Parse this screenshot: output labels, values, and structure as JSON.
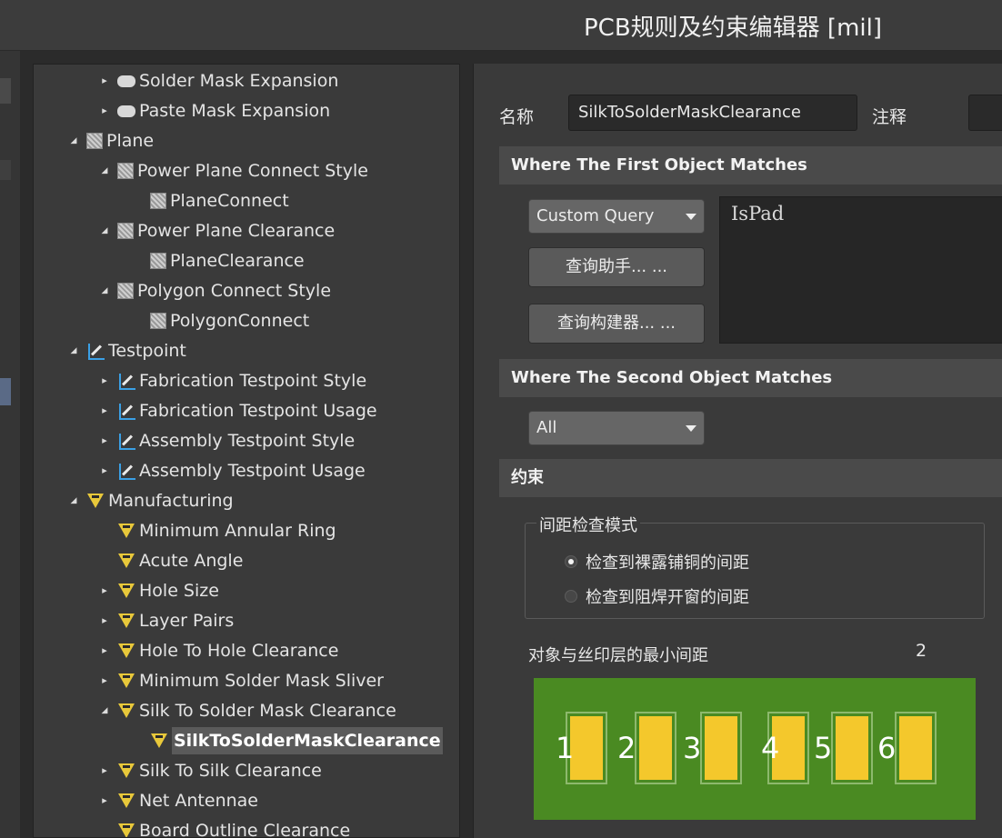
{
  "window": {
    "title": "PCB规则及约束编辑器 [mil]"
  },
  "tree": {
    "items": [
      {
        "label": "Solder Mask Expansion",
        "level": 2,
        "arrow": "collapsed",
        "icon": "mask-icon"
      },
      {
        "label": "Paste Mask Expansion",
        "level": 2,
        "arrow": "collapsed",
        "icon": "mask-icon"
      },
      {
        "label": "Plane",
        "level": 1,
        "arrow": "expanded",
        "icon": "plane-icon"
      },
      {
        "label": "Power Plane Connect Style",
        "level": 2,
        "arrow": "expanded",
        "icon": "plane-icon"
      },
      {
        "label": "PlaneConnect",
        "level": 3,
        "arrow": "none",
        "icon": "plane-icon"
      },
      {
        "label": "Power Plane Clearance",
        "level": 2,
        "arrow": "expanded",
        "icon": "plane-icon"
      },
      {
        "label": "PlaneClearance",
        "level": 3,
        "arrow": "none",
        "icon": "plane-icon"
      },
      {
        "label": "Polygon Connect Style",
        "level": 2,
        "arrow": "expanded",
        "icon": "plane-icon"
      },
      {
        "label": "PolygonConnect",
        "level": 3,
        "arrow": "none",
        "icon": "plane-icon"
      },
      {
        "label": "Testpoint",
        "level": 1,
        "arrow": "expanded",
        "icon": "testpoint-icon"
      },
      {
        "label": "Fabrication Testpoint Style",
        "level": 2,
        "arrow": "collapsed",
        "icon": "testpoint-icon"
      },
      {
        "label": "Fabrication Testpoint Usage",
        "level": 2,
        "arrow": "collapsed",
        "icon": "testpoint-icon"
      },
      {
        "label": "Assembly Testpoint Style",
        "level": 2,
        "arrow": "collapsed",
        "icon": "testpoint-icon"
      },
      {
        "label": "Assembly Testpoint Usage",
        "level": 2,
        "arrow": "collapsed",
        "icon": "testpoint-icon"
      },
      {
        "label": "Manufacturing",
        "level": 1,
        "arrow": "expanded",
        "icon": "manufacturing-icon"
      },
      {
        "label": "Minimum Annular Ring",
        "level": 2,
        "arrow": "none",
        "icon": "manufacturing-icon"
      },
      {
        "label": "Acute Angle",
        "level": 2,
        "arrow": "none",
        "icon": "manufacturing-icon"
      },
      {
        "label": "Hole Size",
        "level": 2,
        "arrow": "collapsed",
        "icon": "manufacturing-icon"
      },
      {
        "label": "Layer Pairs",
        "level": 2,
        "arrow": "collapsed",
        "icon": "manufacturing-icon"
      },
      {
        "label": "Hole To Hole Clearance",
        "level": 2,
        "arrow": "collapsed",
        "icon": "manufacturing-icon"
      },
      {
        "label": "Minimum Solder Mask Sliver",
        "level": 2,
        "arrow": "collapsed",
        "icon": "manufacturing-icon"
      },
      {
        "label": "Silk To Solder Mask Clearance",
        "level": 2,
        "arrow": "expanded",
        "icon": "manufacturing-icon"
      },
      {
        "label": "SilkToSolderMaskClearance",
        "level": 3,
        "arrow": "none",
        "icon": "manufacturing-icon",
        "selected": true
      },
      {
        "label": "Silk To Silk Clearance",
        "level": 2,
        "arrow": "collapsed",
        "icon": "manufacturing-icon"
      },
      {
        "label": "Net Antennae",
        "level": 2,
        "arrow": "collapsed",
        "icon": "manufacturing-icon"
      },
      {
        "label": "Board Outline Clearance",
        "level": 2,
        "arrow": "none",
        "icon": "manufacturing-icon"
      }
    ]
  },
  "editor": {
    "name_label": "名称",
    "name_value": "SilkToSolderMaskClearance",
    "comment_label": "注释",
    "comment_value": "",
    "first_object": {
      "header": "Where The First Object Matches",
      "combo_value": "Custom Query",
      "query_helper_button": "查询助手... ...",
      "query_builder_button": "查询构建器... ...",
      "query_text": "IsPad"
    },
    "second_object": {
      "header": "Where The Second Object Matches",
      "combo_value": "All"
    },
    "constraints": {
      "header": "约束",
      "check_mode_title": "间距检查模式",
      "option_exposed_copper": "检查到裸露铺铜的间距",
      "option_mask_opening": "检查到阻焊开窗的间距",
      "selected_option": "option_exposed_copper",
      "min_clearance_label": "对象与丝印层的最小间距",
      "min_clearance_value": "2"
    },
    "preview": {
      "pad_numbers": [
        "1",
        "2",
        "3",
        "4",
        "5",
        "6"
      ],
      "colors": {
        "board": "#4a8a22",
        "pad": "#f4c82c",
        "pad_outline": "#cfe8b8",
        "label": "#ffffff"
      }
    }
  }
}
